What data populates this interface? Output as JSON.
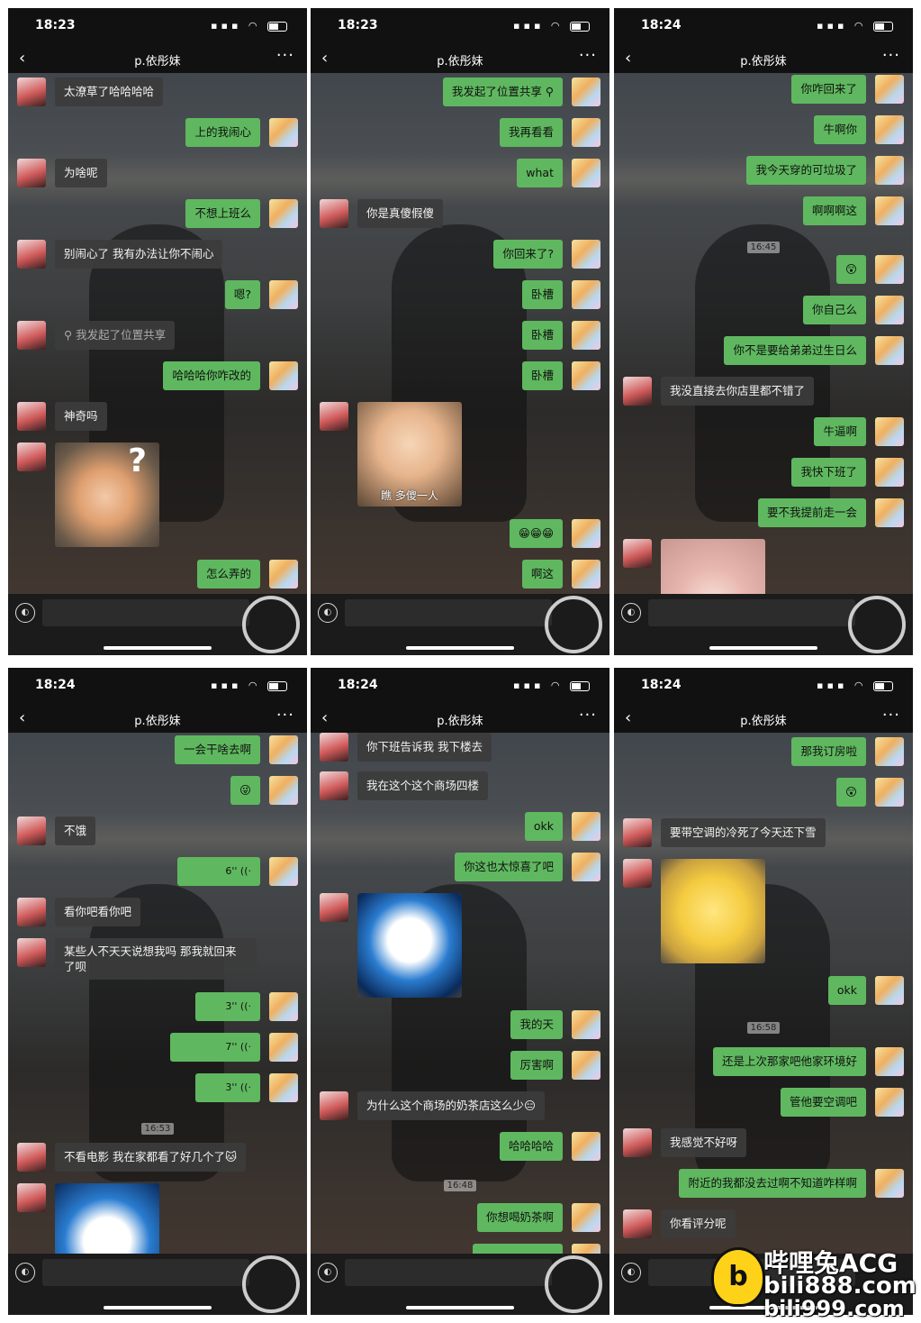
{
  "app": {
    "chat_title": "p.依彤妹",
    "back_icon": "chevron-left-icon",
    "more_label": "···"
  },
  "screens": [
    {
      "time": "18:23",
      "messages": [
        {
          "side": "them",
          "type": "text",
          "text": "太潦草了哈哈哈哈"
        },
        {
          "side": "me",
          "type": "text",
          "text": "上的我闹心"
        },
        {
          "side": "them",
          "type": "text",
          "text": "为啥呢"
        },
        {
          "side": "me",
          "type": "text",
          "text": "不想上班么"
        },
        {
          "side": "them",
          "type": "text",
          "text": "别闹心了  我有办法让你不闹心"
        },
        {
          "side": "me",
          "type": "text",
          "text": "嗯?"
        },
        {
          "side": "them",
          "type": "location",
          "text": "我发起了位置共享"
        },
        {
          "side": "me",
          "type": "text",
          "text": "哈哈哈你咋改的"
        },
        {
          "side": "them",
          "type": "text",
          "text": "神奇吗"
        },
        {
          "side": "them",
          "type": "sticker",
          "text": "?"
        },
        {
          "side": "me",
          "type": "text",
          "text": "怎么弄的"
        }
      ]
    },
    {
      "time": "18:23",
      "messages": [
        {
          "side": "me",
          "type": "location",
          "text": "我发起了位置共享"
        },
        {
          "side": "me",
          "type": "text",
          "text": "我再看看"
        },
        {
          "side": "me",
          "type": "text",
          "text": "what"
        },
        {
          "side": "them",
          "type": "text",
          "text": "你是真傻假傻"
        },
        {
          "side": "me",
          "type": "text",
          "text": "你回来了?"
        },
        {
          "side": "me",
          "type": "text",
          "text": "卧槽"
        },
        {
          "side": "me",
          "type": "text",
          "text": "卧槽"
        },
        {
          "side": "me",
          "type": "text",
          "text": "卧槽"
        },
        {
          "side": "them",
          "type": "sticker",
          "text": "瞧  多傻一人"
        },
        {
          "side": "me",
          "type": "text",
          "text": "😁😁😁"
        },
        {
          "side": "me",
          "type": "text",
          "text": "啊这"
        }
      ]
    },
    {
      "time": "18:24",
      "messages": [
        {
          "side": "me",
          "type": "text",
          "text": "你咋回来了"
        },
        {
          "side": "me",
          "type": "text",
          "text": "牛啊你"
        },
        {
          "side": "me",
          "type": "text",
          "text": "我今天穿的可垃圾了"
        },
        {
          "side": "me",
          "type": "text",
          "text": "啊啊啊这"
        },
        {
          "type": "time",
          "text": "16:45"
        },
        {
          "side": "me",
          "type": "text",
          "text": "😲"
        },
        {
          "side": "me",
          "type": "text",
          "text": "你自己么"
        },
        {
          "side": "me",
          "type": "text",
          "text": "你不是要给弟弟过生日么"
        },
        {
          "side": "them",
          "type": "text",
          "text": "我没直接去你店里都不错了"
        },
        {
          "side": "me",
          "type": "text",
          "text": "牛逼啊"
        },
        {
          "side": "me",
          "type": "text",
          "text": "我快下班了"
        },
        {
          "side": "me",
          "type": "text",
          "text": "要不我提前走一会"
        },
        {
          "side": "them",
          "type": "sticker",
          "text": ""
        }
      ]
    },
    {
      "time": "18:24",
      "messages": [
        {
          "side": "me",
          "type": "text",
          "text": "一会干啥去啊"
        },
        {
          "side": "me",
          "type": "text",
          "text": "😜"
        },
        {
          "side": "them",
          "type": "text",
          "text": "不饿"
        },
        {
          "side": "me",
          "type": "voice",
          "text": "6''"
        },
        {
          "side": "them",
          "type": "text",
          "text": "看你吧看你吧"
        },
        {
          "side": "them",
          "type": "text2",
          "text": "某些人不天天说想我吗 那我就回来",
          "text2": "了呗"
        },
        {
          "side": "me",
          "type": "voice",
          "text": "3''"
        },
        {
          "side": "me",
          "type": "voice",
          "text": "7''"
        },
        {
          "side": "me",
          "type": "voice",
          "text": "3''"
        },
        {
          "type": "time",
          "text": "16:53"
        },
        {
          "side": "them",
          "type": "text",
          "text": "不看电影 我在家都看了好几个了🐱"
        },
        {
          "side": "them",
          "type": "sticker",
          "text": ""
        }
      ]
    },
    {
      "time": "18:24",
      "messages": [
        {
          "side": "them",
          "type": "text",
          "text": "你下班告诉我  我下楼去"
        },
        {
          "side": "them",
          "type": "text",
          "text": "我在这个这个商场四楼"
        },
        {
          "side": "me",
          "type": "text",
          "text": "okk"
        },
        {
          "side": "me",
          "type": "text",
          "text": "你这也太惊喜了吧"
        },
        {
          "side": "them",
          "type": "sticker",
          "text": ""
        },
        {
          "side": "me",
          "type": "text",
          "text": "我的天"
        },
        {
          "side": "me",
          "type": "text",
          "text": "厉害啊"
        },
        {
          "side": "them",
          "type": "text",
          "text": "为什么这个商场的奶茶店这么少😑"
        },
        {
          "side": "me",
          "type": "text",
          "text": "哈哈哈哈"
        },
        {
          "type": "time",
          "text": "16:48"
        },
        {
          "side": "me",
          "type": "text",
          "text": "你想喝奶茶啊"
        }
      ]
    },
    {
      "time": "18:24",
      "messages": [
        {
          "side": "me",
          "type": "text",
          "text": "那我订房啦"
        },
        {
          "side": "me",
          "type": "text",
          "text": "😲"
        },
        {
          "side": "them",
          "type": "text",
          "text": "要带空调的冷死了今天还下雪"
        },
        {
          "side": "them",
          "type": "sticker",
          "text": ""
        },
        {
          "side": "me",
          "type": "text",
          "text": "okk"
        },
        {
          "type": "time",
          "text": "16:58"
        },
        {
          "side": "me",
          "type": "text",
          "text": "还是上次那家吧他家环境好"
        },
        {
          "side": "me",
          "type": "text",
          "text": "管他要空调吧"
        },
        {
          "side": "them",
          "type": "text",
          "text": "我感觉不好呀"
        },
        {
          "side": "me",
          "type": "text",
          "text": "附近的我都没去过啊不知道咋样啊"
        },
        {
          "side": "them",
          "type": "text",
          "text": "你看评分呢"
        }
      ]
    }
  ],
  "watermark": {
    "line1": "哔哩兔ACG",
    "line2": "bili888.com",
    "line3": "bili999.com"
  }
}
